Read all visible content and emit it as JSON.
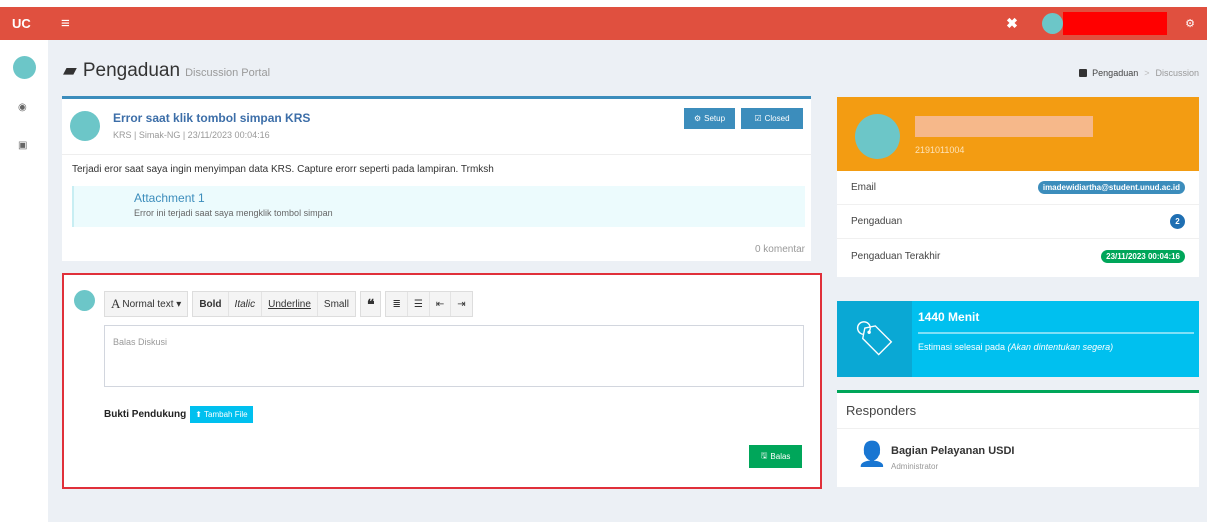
{
  "topbar": {
    "logo": "UC",
    "menu_icon": "≡",
    "tools_icon": "✖",
    "settings_icon": "⚙"
  },
  "sidebar": {
    "icons": [
      "dashboard-icon",
      "id-card-icon"
    ]
  },
  "page": {
    "title": "Pengaduan",
    "subtitle": "Discussion Portal",
    "breadcrumb": [
      "Pengaduan",
      "Discussion"
    ]
  },
  "ticket": {
    "title": "Error saat klik tombol simpan KRS",
    "meta": "KRS | Simak-NG | 23/11/2023 00:04:16",
    "setup_label": "Setup",
    "closed_label": "Closed",
    "description": "Terjadi eror saat saya ingin menyimpan data KRS. Capture erorr seperti pada lampiran. Trmksh",
    "attachment_title": "Attachment 1",
    "attachment_desc": "Error ini terjadi saat saya mengklik tombol simpan",
    "comments": "0 komentar"
  },
  "reply": {
    "toolbar": {
      "normal_text": "Normal text",
      "bold": "Bold",
      "italic": "Italic",
      "underline": "Underline",
      "small": "Small"
    },
    "placeholder": "Balas Diskusi",
    "bukti_label": "Bukti Pendukung",
    "tambah_file": "Tambah File",
    "balas_label": "Balas"
  },
  "profile": {
    "id": "2191011004",
    "email_label": "Email",
    "email_value": "imadewidiartha@student.unud.ac.id",
    "pengaduan_label": "Pengaduan",
    "pengaduan_count": "2",
    "terakhir_label": "Pengaduan Terakhir",
    "terakhir_value": "23/11/2023 00:04:16"
  },
  "estimate": {
    "title": "1440 Menit",
    "text_prefix": "Estimasi selesai pada ",
    "text_italic": "(Akan dintentukan segera)"
  },
  "responders": {
    "title": "Responders",
    "name": "Bagian Pelayanan USDI",
    "role": "Administrator"
  }
}
